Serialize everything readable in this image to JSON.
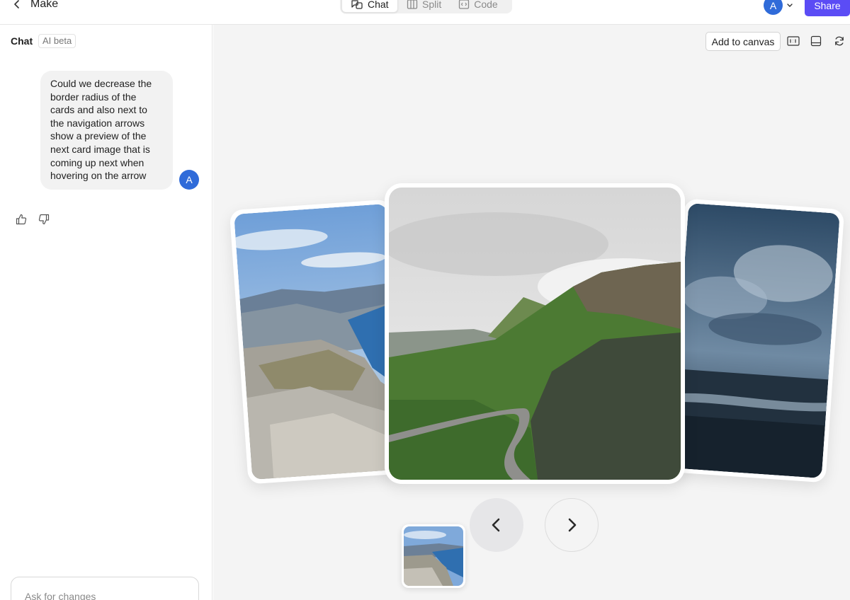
{
  "app": {
    "title": "Make"
  },
  "view_modes": [
    {
      "label": "Chat",
      "icon": "chat-bubble-icon",
      "active": true
    },
    {
      "label": "Split",
      "icon": "split-columns-icon",
      "active": false
    },
    {
      "label": "Code",
      "icon": "code-icon",
      "active": false
    }
  ],
  "user": {
    "initial": "A",
    "color": "#2f6bd9"
  },
  "header": {
    "share_label": "Share",
    "share_color": "#5b4cf5"
  },
  "chat": {
    "title": "Chat",
    "badge": "AI beta",
    "messages": [
      {
        "author_initial": "A",
        "text": "Could we decrease the border radius of the cards and also next to the navigation arrows show a preview of the next card image that is coming up next when hovering on the arrow"
      }
    ],
    "feedback": {
      "like_icon": "thumbs-up-icon",
      "dislike_icon": "thumbs-down-icon"
    },
    "input": {
      "placeholder": "Ask for changes",
      "value": ""
    }
  },
  "canvas": {
    "add_to_canvas_label": "Add to canvas",
    "tools": [
      "aspect-ratio-icon",
      "panel-layout-icon",
      "refresh-icon"
    ],
    "carousel": {
      "cards": [
        {
          "position": "left",
          "image": "fjord-cliff-photo"
        },
        {
          "position": "center",
          "image": "green-ridge-road-photo"
        },
        {
          "position": "right",
          "image": "stormy-sea-photo"
        }
      ],
      "prev_icon": "chevron-left-icon",
      "next_icon": "chevron-right-icon",
      "preview_thumbnail": "fjord-cliff-photo"
    }
  }
}
